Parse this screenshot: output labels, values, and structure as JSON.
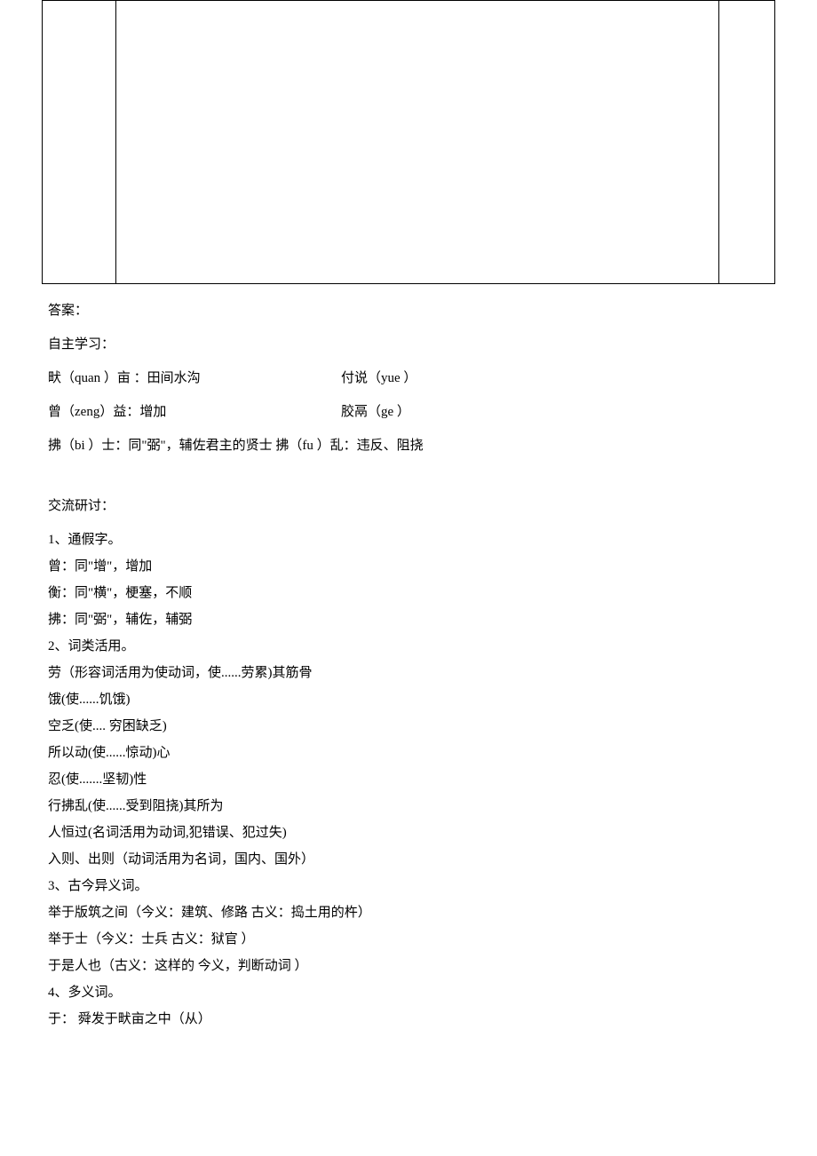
{
  "answer_header": "答案：",
  "self_study_header": "自主学习：",
  "self_study": {
    "row1_left": "畎（quan ）亩 ：田间水沟",
    "row1_right": "付说（yue ）",
    "row2_left": "曾（zeng）益：增加",
    "row2_right": "胶鬲（ge   ）",
    "row3": "拂（bi ）士：同\"弼\"，辅佐君主的贤士  拂（fu ）乱：违反、阻挠"
  },
  "discuss_header": "交流研讨：",
  "sec1": {
    "title": "1、通假字。",
    "l1": "曾：同\"增\"，增加",
    "l2": "衡：同\"横\"，梗塞，不顺",
    "l3": "拂：同\"弼\"，辅佐，辅弼"
  },
  "sec2": {
    "title": "2、词类活用。",
    "l1": "劳（形容词活用为使动词，使......劳累)其筋骨",
    "l2": "饿(使......饥饿)",
    "l3": "空乏(使....   穷困缺乏)",
    "l4": "所以动(使......惊动)心",
    "l5": "忍(使.......坚韧)性",
    "l6": "行拂乱(使......受到阻挠)其所为",
    "l7": "人恒过(名词活用为动词,犯错误、犯过失)",
    "l8": "入则、出则（动词活用为名词，国内、国外）"
  },
  "sec3": {
    "title": "3、古今异义词。",
    "l1": "举于版筑之间（今义：建筑、修路     古义：捣土用的杵）",
    "l2": "举于士（今义：士兵     古义：狱官    ）",
    "l3": "于是人也（古义：这样的   今义，判断动词  ）"
  },
  "sec4": {
    "title": "4、多义词。",
    "l1": "于：  舜发于畎亩之中（从）"
  }
}
